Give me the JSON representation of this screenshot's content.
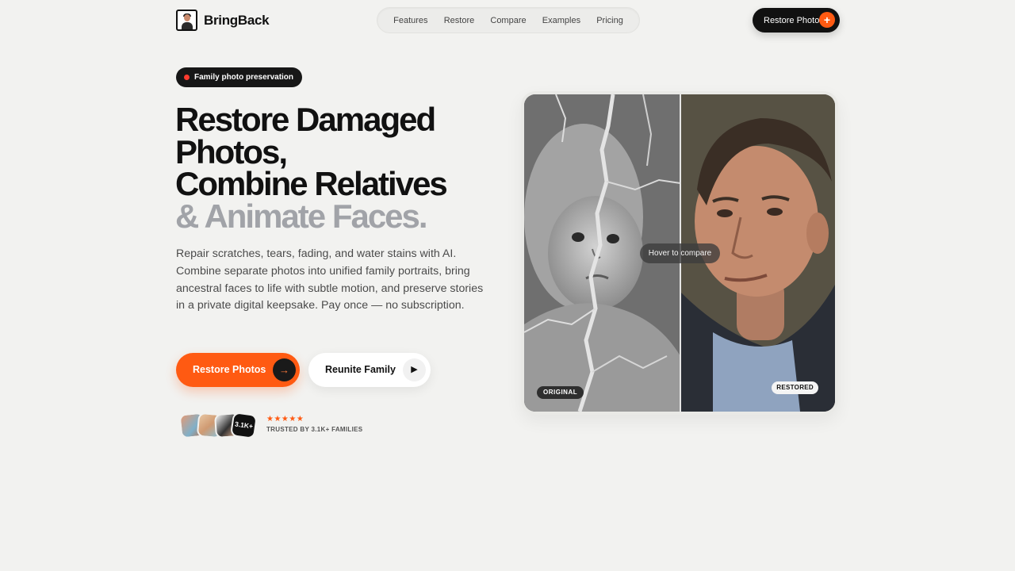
{
  "brand": {
    "name": "BringBack"
  },
  "nav": {
    "links": [
      "Features",
      "Restore",
      "Compare",
      "Examples",
      "Pricing"
    ],
    "cta_label": "Restore Photo",
    "cta_icon": "plus-sparkle-icon"
  },
  "hero": {
    "badge": "Family photo preservation",
    "headline_line1": "Restore Damaged",
    "headline_line2": "Photos,",
    "headline_line3": "Combine Relatives",
    "headline_line4": "& Animate Faces.",
    "subtext": "Repair scratches, tears, fading, and water stains with AI. Combine separate photos into unified family portraits, bring ancestral faces to life with subtle motion, and preserve stories in a private digital keepsake. Pay once — no subscription.",
    "primary_button": "Restore Photos",
    "secondary_button": "Reunite Family",
    "social_proof": {
      "count_badge": "3.1K+",
      "stars": "★★★★★",
      "trusted_text": "TRUSTED BY 3.1K+ FAMILIES"
    }
  },
  "compare": {
    "hover_label": "Hover to compare",
    "original_label": "ORIGINAL",
    "restored_label": "RESTORED"
  },
  "colors": {
    "accent": "#ff5a12",
    "background": "#f2f2f0",
    "dark": "#111111",
    "muted_heading": "#a1a3a8"
  }
}
